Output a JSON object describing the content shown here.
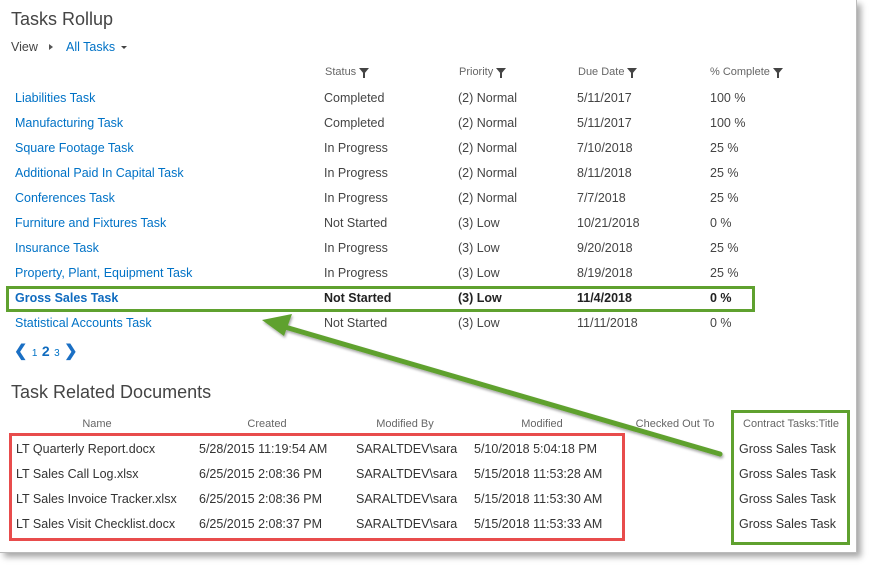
{
  "tasks": {
    "title": "Tasks Rollup",
    "view_label": "View",
    "view_value": "All Tasks",
    "columns": [
      "Status",
      "Priority",
      "Due Date",
      "% Complete"
    ],
    "rows": [
      {
        "name": "Liabilities Task",
        "status": "Completed",
        "priority": "(2) Normal",
        "due": "5/11/2017",
        "complete": "100 %"
      },
      {
        "name": "Manufacturing Task",
        "status": "Completed",
        "priority": "(2) Normal",
        "due": "5/11/2017",
        "complete": "100 %"
      },
      {
        "name": "Square Footage Task",
        "status": "In Progress",
        "priority": "(2) Normal",
        "due": "7/10/2018",
        "complete": "25 %"
      },
      {
        "name": "Additional Paid In Capital Task",
        "status": "In Progress",
        "priority": "(2) Normal",
        "due": "8/11/2018",
        "complete": "25 %"
      },
      {
        "name": "Conferences Task",
        "status": "In Progress",
        "priority": "(2) Normal",
        "due": "7/7/2018",
        "complete": "25 %"
      },
      {
        "name": "Furniture and Fixtures Task",
        "status": "Not Started",
        "priority": "(3) Low",
        "due": "10/21/2018",
        "complete": "0 %"
      },
      {
        "name": "Insurance Task",
        "status": "In Progress",
        "priority": "(3) Low",
        "due": "9/20/2018",
        "complete": "25 %"
      },
      {
        "name": "Property, Plant, Equipment Task",
        "status": "In Progress",
        "priority": "(3) Low",
        "due": "8/19/2018",
        "complete": "25 %"
      },
      {
        "name": "Gross Sales Task",
        "status": "Not Started",
        "priority": "(3) Low",
        "due": "11/4/2018",
        "complete": "0 %"
      },
      {
        "name": "Statistical Accounts Task",
        "status": "Not Started",
        "priority": "(3) Low",
        "due": "11/11/2018",
        "complete": "0 %"
      }
    ],
    "pages": [
      "1",
      "2",
      "3"
    ],
    "current_page": "2"
  },
  "docs": {
    "title": "Task Related Documents",
    "columns": [
      "Name",
      "Created",
      "Modified By",
      "Modified",
      "Checked Out To",
      "Contract Tasks:Title"
    ],
    "rows": [
      {
        "name": "LT Quarterly Report.docx",
        "created": "5/28/2015 11:19:54 AM",
        "modified_by": "SARALTDEV\\sara",
        "modified": "5/10/2018 5:04:18 PM",
        "task": "Gross Sales Task"
      },
      {
        "name": "LT Sales Call Log.xlsx",
        "created": "6/25/2015 2:08:36 PM",
        "modified_by": "SARALTDEV\\sara",
        "modified": "5/15/2018 11:53:28 AM",
        "task": "Gross Sales Task"
      },
      {
        "name": "LT Sales Invoice Tracker.xlsx",
        "created": "6/25/2015 2:08:36 PM",
        "modified_by": "SARALTDEV\\sara",
        "modified": "5/15/2018 11:53:30 AM",
        "task": "Gross Sales Task"
      },
      {
        "name": "LT Sales Visit Checklist.docx",
        "created": "6/25/2015 2:08:37 PM",
        "modified_by": "SARALTDEV\\sara",
        "modified": "5/15/2018 11:53:33 AM",
        "task": "Gross Sales Task"
      }
    ]
  },
  "colors": {
    "link": "#0072c6",
    "highlight_green": "#5fa12f",
    "highlight_red": "#e84c4c"
  }
}
